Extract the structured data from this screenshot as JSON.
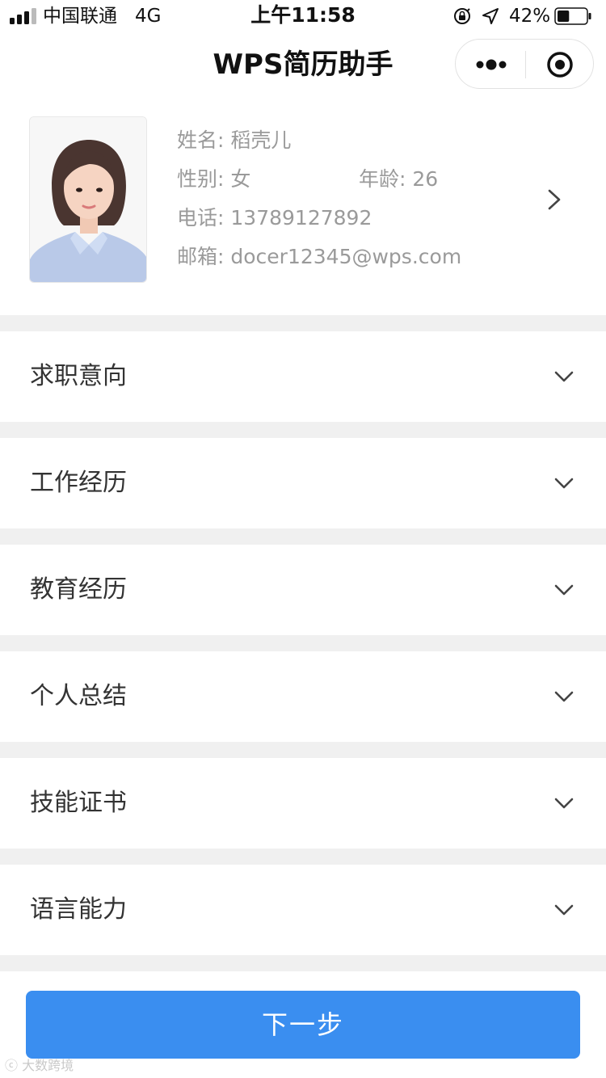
{
  "status_bar": {
    "carrier": "中国联通",
    "network": "4G",
    "time": "上午11:58",
    "battery_percent": "42%",
    "battery_level": 0.42
  },
  "nav": {
    "title": "WPS简历助手",
    "more_icon": "more-dots-icon",
    "close_icon": "target-circle-icon"
  },
  "profile": {
    "name_label": "姓名:",
    "name": "稻壳儿",
    "gender_label": "性别:",
    "gender": "女",
    "age_label": "年龄:",
    "age": "26",
    "phone_label": "电话:",
    "phone": "13789127892",
    "email_label": "邮箱:",
    "email": "docer12345@wps.com"
  },
  "sections": [
    {
      "title": "求职意向"
    },
    {
      "title": "工作经历"
    },
    {
      "title": "教育经历"
    },
    {
      "title": "个人总结"
    },
    {
      "title": "技能证书"
    },
    {
      "title": "语言能力"
    }
  ],
  "footer": {
    "next_label": "下一步",
    "watermark": "大数跨境"
  },
  "colors": {
    "accent": "#3a8ef0",
    "background": "#f0f0f0",
    "card": "#ffffff"
  }
}
